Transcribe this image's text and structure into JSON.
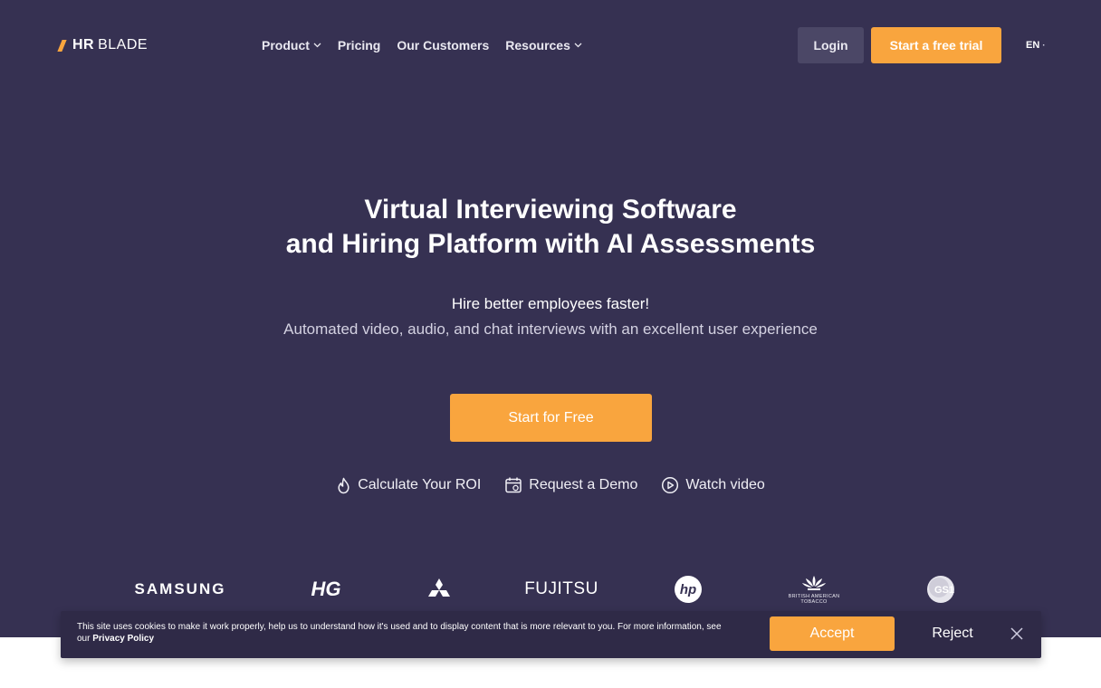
{
  "brand": {
    "logo_bold": "HR",
    "logo_light": "BLADE",
    "accent_color": "#f9a53e",
    "hero_bg": "#363152"
  },
  "nav": {
    "items": [
      {
        "label": "Product",
        "has_dropdown": true
      },
      {
        "label": "Pricing",
        "has_dropdown": false
      },
      {
        "label": "Our Customers",
        "has_dropdown": false
      },
      {
        "label": "Resources",
        "has_dropdown": true
      }
    ],
    "login_label": "Login",
    "trial_label": "Start a free trial",
    "language": "EN"
  },
  "hero": {
    "headline_line1": "Virtual Interviewing Software",
    "headline_line2": "and Hiring Platform with AI Assessments",
    "subtitle": "Hire better employees faster!",
    "description": "Automated video, audio, and chat interviews with an excellent user experience",
    "cta_label": "Start for Free",
    "links": [
      {
        "label": "Calculate Your ROI",
        "icon": "flame-icon"
      },
      {
        "label": "Request a Demo",
        "icon": "calendar-icon"
      },
      {
        "label": "Watch video",
        "icon": "play-circle-icon"
      }
    ]
  },
  "clients": {
    "samsung": "SAMSUNG",
    "hg": "HG",
    "fujitsu": "FUJITSU",
    "hp": "hp",
    "bat_line1": "BRITISH AMERICAN",
    "bat_line2": "TOBACCO",
    "gs1": "GS1"
  },
  "cookie_banner": {
    "text": "This site uses cookies to make it work properly, help us to understand how it's used and to display content that is more relevant to you. For more information, see our",
    "policy_link": "Privacy Policy",
    "accept_label": "Accept",
    "reject_label": "Reject"
  }
}
